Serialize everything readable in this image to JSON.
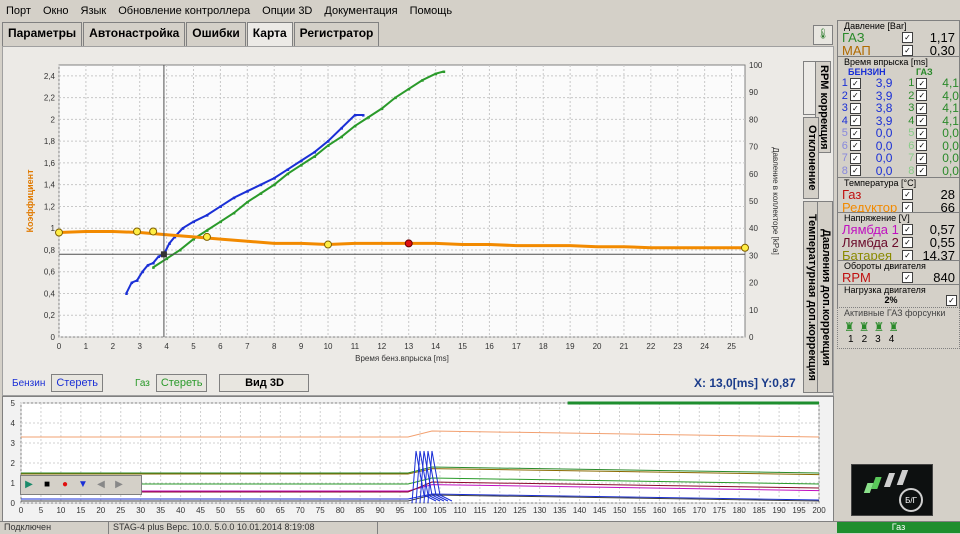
{
  "menu": [
    "Порт",
    "Окно",
    "Язык",
    "Обновление контроллера",
    "Опции 3D",
    "Документация",
    "Помощь"
  ],
  "tabs": [
    "Параметры",
    "Автонастройка",
    "Ошибки",
    "Карта",
    "Регистратор"
  ],
  "active_tab": "Карта",
  "vertical_tabs": [
    "Карта",
    "RPM коррекция",
    "Отклонение",
    "Температурная доп.коррекция",
    "Давления доп.коррекция"
  ],
  "chart_data": {
    "type": "scatter",
    "xlabel": "Время бенз.впрыска [ms]",
    "ylabel": "Коэффициент",
    "y2label": "Давление в коллекторе [kPa]",
    "xlim": [
      0,
      25.5
    ],
    "xticks": [
      0,
      1,
      2,
      3,
      4,
      5,
      6,
      7,
      8,
      9,
      10,
      11,
      12,
      13,
      14,
      15,
      16,
      17,
      18,
      19,
      20,
      21,
      22,
      23,
      24,
      25
    ],
    "ylim": [
      0,
      2.5
    ],
    "yticks": [
      0,
      0.2,
      0.4,
      0.6,
      0.8,
      1,
      1.2,
      1.4,
      1.6,
      1.8,
      2,
      2.2,
      2.4
    ],
    "y2lim": [
      0,
      100
    ],
    "y2ticks": [
      0,
      10,
      20,
      30,
      40,
      50,
      60,
      70,
      80,
      90,
      100
    ],
    "cursor": {
      "x": 3.9,
      "y": 0.76
    },
    "series": [
      {
        "name": "Бензин",
        "color": "#1a2fd6",
        "points": [
          [
            2.5,
            0.4
          ],
          [
            2.7,
            0.5
          ],
          [
            2.9,
            0.52
          ],
          [
            3.1,
            0.6
          ],
          [
            3.3,
            0.66
          ],
          [
            3.5,
            0.68
          ],
          [
            3.7,
            0.74
          ],
          [
            3.9,
            0.76
          ],
          [
            4.1,
            0.86
          ],
          [
            4.3,
            0.92
          ],
          [
            4.6,
            1.0
          ],
          [
            5.0,
            1.06
          ],
          [
            5.5,
            1.12
          ],
          [
            6.0,
            1.2
          ],
          [
            6.5,
            1.28
          ],
          [
            7.0,
            1.34
          ],
          [
            7.5,
            1.4
          ],
          [
            8.0,
            1.46
          ],
          [
            8.5,
            1.54
          ],
          [
            9.0,
            1.62
          ],
          [
            9.5,
            1.7
          ],
          [
            10.0,
            1.8
          ],
          [
            10.5,
            1.92
          ],
          [
            11.0,
            2.04
          ],
          [
            11.3,
            2.04
          ]
        ]
      },
      {
        "name": "Газ",
        "color": "#2a9a2a",
        "points": [
          [
            3.5,
            0.64
          ],
          [
            4.0,
            0.72
          ],
          [
            4.5,
            0.8
          ],
          [
            5.0,
            0.9
          ],
          [
            5.5,
            0.98
          ],
          [
            6.0,
            1.06
          ],
          [
            6.5,
            1.14
          ],
          [
            7.0,
            1.24
          ],
          [
            7.5,
            1.32
          ],
          [
            8.0,
            1.4
          ],
          [
            8.5,
            1.5
          ],
          [
            9.0,
            1.58
          ],
          [
            9.5,
            1.66
          ],
          [
            10.0,
            1.76
          ],
          [
            10.5,
            1.84
          ],
          [
            11.0,
            1.94
          ],
          [
            11.5,
            2.02
          ],
          [
            12.0,
            2.1
          ],
          [
            12.5,
            2.2
          ],
          [
            13.0,
            2.28
          ],
          [
            13.5,
            2.36
          ],
          [
            14.0,
            2.42
          ],
          [
            14.3,
            2.44
          ]
        ]
      },
      {
        "name": "Давление",
        "color": "#f28a00",
        "points": [
          [
            0,
            0.96
          ],
          [
            1,
            0.97
          ],
          [
            2,
            0.97
          ],
          [
            3,
            0.96
          ],
          [
            4,
            0.94
          ],
          [
            5,
            0.92
          ],
          [
            6,
            0.9
          ],
          [
            7,
            0.88
          ],
          [
            8,
            0.86
          ],
          [
            9,
            0.86
          ],
          [
            10,
            0.85
          ],
          [
            11,
            0.86
          ],
          [
            12,
            0.86
          ],
          [
            13,
            0.86
          ],
          [
            14,
            0.86
          ],
          [
            15,
            0.85
          ],
          [
            16,
            0.85
          ],
          [
            17,
            0.84
          ],
          [
            18,
            0.84
          ],
          [
            19,
            0.84
          ],
          [
            20,
            0.83
          ],
          [
            21,
            0.83
          ],
          [
            22,
            0.82
          ],
          [
            23,
            0.82
          ],
          [
            24,
            0.82
          ],
          [
            25,
            0.82
          ],
          [
            25.5,
            0.82
          ]
        ]
      }
    ],
    "markers_yellow": [
      [
        0,
        0.96
      ],
      [
        2.9,
        0.97
      ],
      [
        3.5,
        0.97
      ],
      [
        5.5,
        0.92
      ],
      [
        10.0,
        0.85
      ],
      [
        25.5,
        0.82
      ]
    ],
    "marker_red": [
      13.0,
      0.86
    ]
  },
  "legend": {
    "petrol_label": "Бензин",
    "petrol_clear": "Стереть",
    "gas_label": "Газ",
    "gas_clear": "Стереть",
    "view3d": "Вид 3D"
  },
  "readout": {
    "x_label": "X:",
    "x_value": "13,0[ms]",
    "y_label": "Y:",
    "y_value": "0,87"
  },
  "lower_chart": {
    "yticks": [
      0,
      1,
      2,
      3,
      4,
      5
    ],
    "xticks": [
      0,
      5,
      10,
      15,
      20,
      25,
      30,
      35,
      40,
      45,
      50,
      55,
      60,
      65,
      70,
      75,
      80,
      85,
      90,
      95,
      100,
      105,
      110,
      115,
      120,
      125,
      130,
      135,
      140,
      145,
      150,
      155,
      160,
      165,
      170,
      175,
      180,
      185,
      190,
      195,
      200
    ]
  },
  "pressure": {
    "title": "Давление [Bar]",
    "gas_label": "ГАЗ",
    "gas_value": "1,17",
    "map_label": "МАП",
    "map_value": "0,30"
  },
  "injection": {
    "title": "Время впрыска [ms]",
    "col_petrol": "БЕНЗИН",
    "col_gas": "ГАЗ",
    "rows": [
      {
        "n": "1",
        "p": "3,9",
        "g": "4,1"
      },
      {
        "n": "2",
        "p": "3,9",
        "g": "4,0"
      },
      {
        "n": "3",
        "p": "3,8",
        "g": "4,1"
      },
      {
        "n": "4",
        "p": "3,9",
        "g": "4,1"
      },
      {
        "n": "5",
        "p": "0,0",
        "g": "0,0"
      },
      {
        "n": "6",
        "p": "0,0",
        "g": "0,0"
      },
      {
        "n": "7",
        "p": "0,0",
        "g": "0,0"
      },
      {
        "n": "8",
        "p": "0,0",
        "g": "0,0"
      }
    ]
  },
  "temperature": {
    "title": "Температура [°C]",
    "gas_label": "Газ",
    "gas_value": "28",
    "reducer_label": "Редуктор",
    "reducer_value": "66"
  },
  "voltage": {
    "title": "Напряжение [V]",
    "l1_label": "Лямбда 1",
    "l1_value": "0,57",
    "l2_label": "Лямбда 2",
    "l2_value": "0,55",
    "bat_label": "Батарея",
    "bat_value": "14,37"
  },
  "rpm": {
    "title": "Обороты двигателя",
    "label": "RPM",
    "value": "840"
  },
  "load": {
    "title": "Нагрузка двигателя",
    "value": "2%"
  },
  "injectors": {
    "title": "Активные ГАЗ форсунки",
    "numbers": [
      "1",
      "2",
      "3",
      "4"
    ]
  },
  "logo_text": "Б/Г",
  "status": {
    "connected": "Подключен",
    "version": "STAG-4 plus   Верс. 10.0. 5.0.0   10.01.2014 8:19:08",
    "gas_mode": "Газ"
  }
}
